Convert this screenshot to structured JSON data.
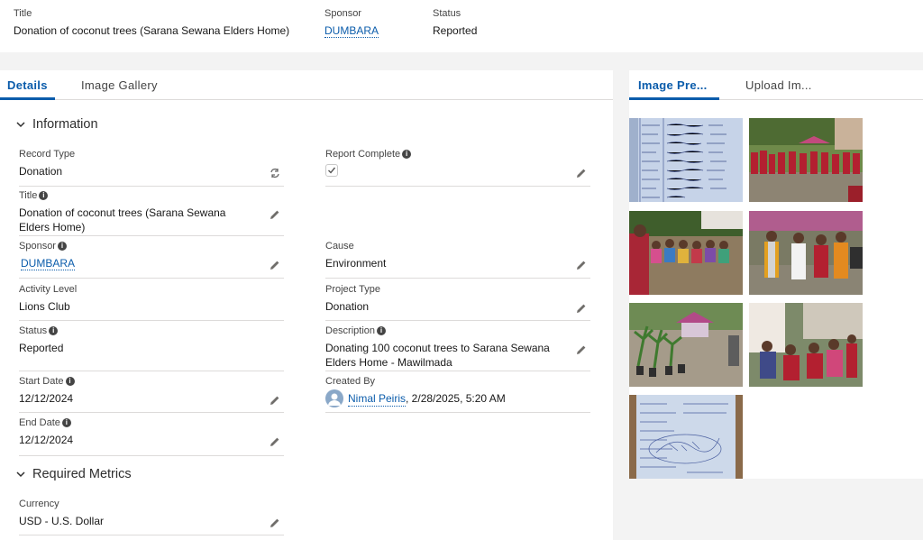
{
  "header": {
    "title_label": "Title",
    "title_value": "Donation of coconut trees (Sarana Sewana Elders Home)",
    "sponsor_label": "Sponsor",
    "sponsor_value": "DUMBARA",
    "status_label": "Status",
    "status_value": "Reported"
  },
  "tabs": {
    "details": "Details",
    "gallery": "Image Gallery"
  },
  "sections": {
    "information": "Information",
    "metrics": "Required Metrics"
  },
  "fields": {
    "record_type": {
      "label": "Record Type",
      "value": "Donation"
    },
    "report_complete": {
      "label": "Report Complete",
      "checked": true
    },
    "title": {
      "label": "Title",
      "value": "Donation of coconut trees (Sarana Sewana Elders Home)"
    },
    "sponsor": {
      "label": "Sponsor",
      "value": "DUMBARA"
    },
    "cause": {
      "label": "Cause",
      "value": "Environment"
    },
    "activity_level": {
      "label": "Activity Level",
      "value": "Lions Club"
    },
    "project_type": {
      "label": "Project Type",
      "value": "Donation"
    },
    "status": {
      "label": "Status",
      "value": "Reported"
    },
    "description": {
      "label": "Description",
      "value": "Donating 100 coconut trees to Sarana Sewana Elders Home - Mawilmada"
    },
    "start_date": {
      "label": "Start Date",
      "value": "12/12/2024"
    },
    "created_by": {
      "label": "Created By",
      "user": "Nimal Peiris",
      "timestamp": ", 2/28/2025, 5:20 AM"
    },
    "end_date": {
      "label": "End Date",
      "value": "12/12/2024"
    },
    "currency": {
      "label": "Currency",
      "value": "USD - U.S. Dollar"
    }
  },
  "right_tabs": {
    "preview": "Image Pre...",
    "upload": "Upload Im..."
  },
  "colors": {
    "brand_blue": "#0b5cab",
    "icon_gray": "#444444",
    "border": "#dddbda"
  }
}
